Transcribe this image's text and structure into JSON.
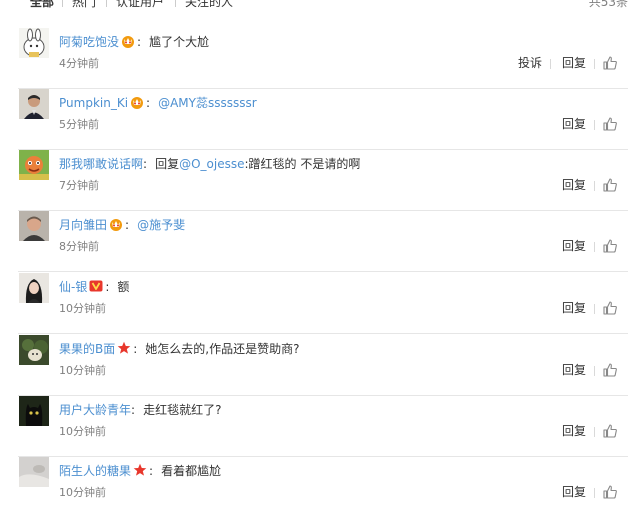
{
  "tabs": [
    "全部",
    "热门",
    "认证用户",
    "关注的人"
  ],
  "total": "共53条",
  "comments": [
    {
      "user": "阿菊吃饱没",
      "badge": "crown-badge-icon",
      "text": "尴了个大尬",
      "time": "4分钟前",
      "report": "投诉",
      "reply": "回复"
    },
    {
      "user": "Pumpkin_Ki",
      "badge": "crown-badge-icon",
      "mention": "@AMY蕊sssssssr",
      "time": "5分钟前",
      "reply": "回复"
    },
    {
      "user": "那我哪敢说话啊",
      "text_prefix": "回复",
      "mention": "@O_ojesse",
      "text": ":蹭红毯的 不是请的啊",
      "time": "7分钟前",
      "reply": "回复"
    },
    {
      "user": "月向雏田",
      "badge": "crown-badge-icon",
      "mention": "@施予斐",
      "time": "8分钟前",
      "reply": "回复"
    },
    {
      "user": "仙-银",
      "badge": "verified-v-icon",
      "text": "额",
      "time": "10分钟前",
      "reply": "回复"
    },
    {
      "user": "果果的B面",
      "badge": "star-badge-icon",
      "text": "她怎么去的,作品还是赞助商?",
      "time": "10分钟前",
      "reply": "回复"
    },
    {
      "user": "用户大龄青年",
      "text": "走红毯就红了?",
      "time": "10分钟前",
      "reply": "回复"
    },
    {
      "user": "陌生人的糖果",
      "badge": "star-badge-icon",
      "text": "看着都尴尬",
      "time": "10分钟前",
      "reply": "回复"
    }
  ],
  "colors": {
    "link": "#4c8fd0",
    "meta": "#808080",
    "divider": "#e6e6e6",
    "star": "#e8372c",
    "crown": "#f29a0e"
  }
}
